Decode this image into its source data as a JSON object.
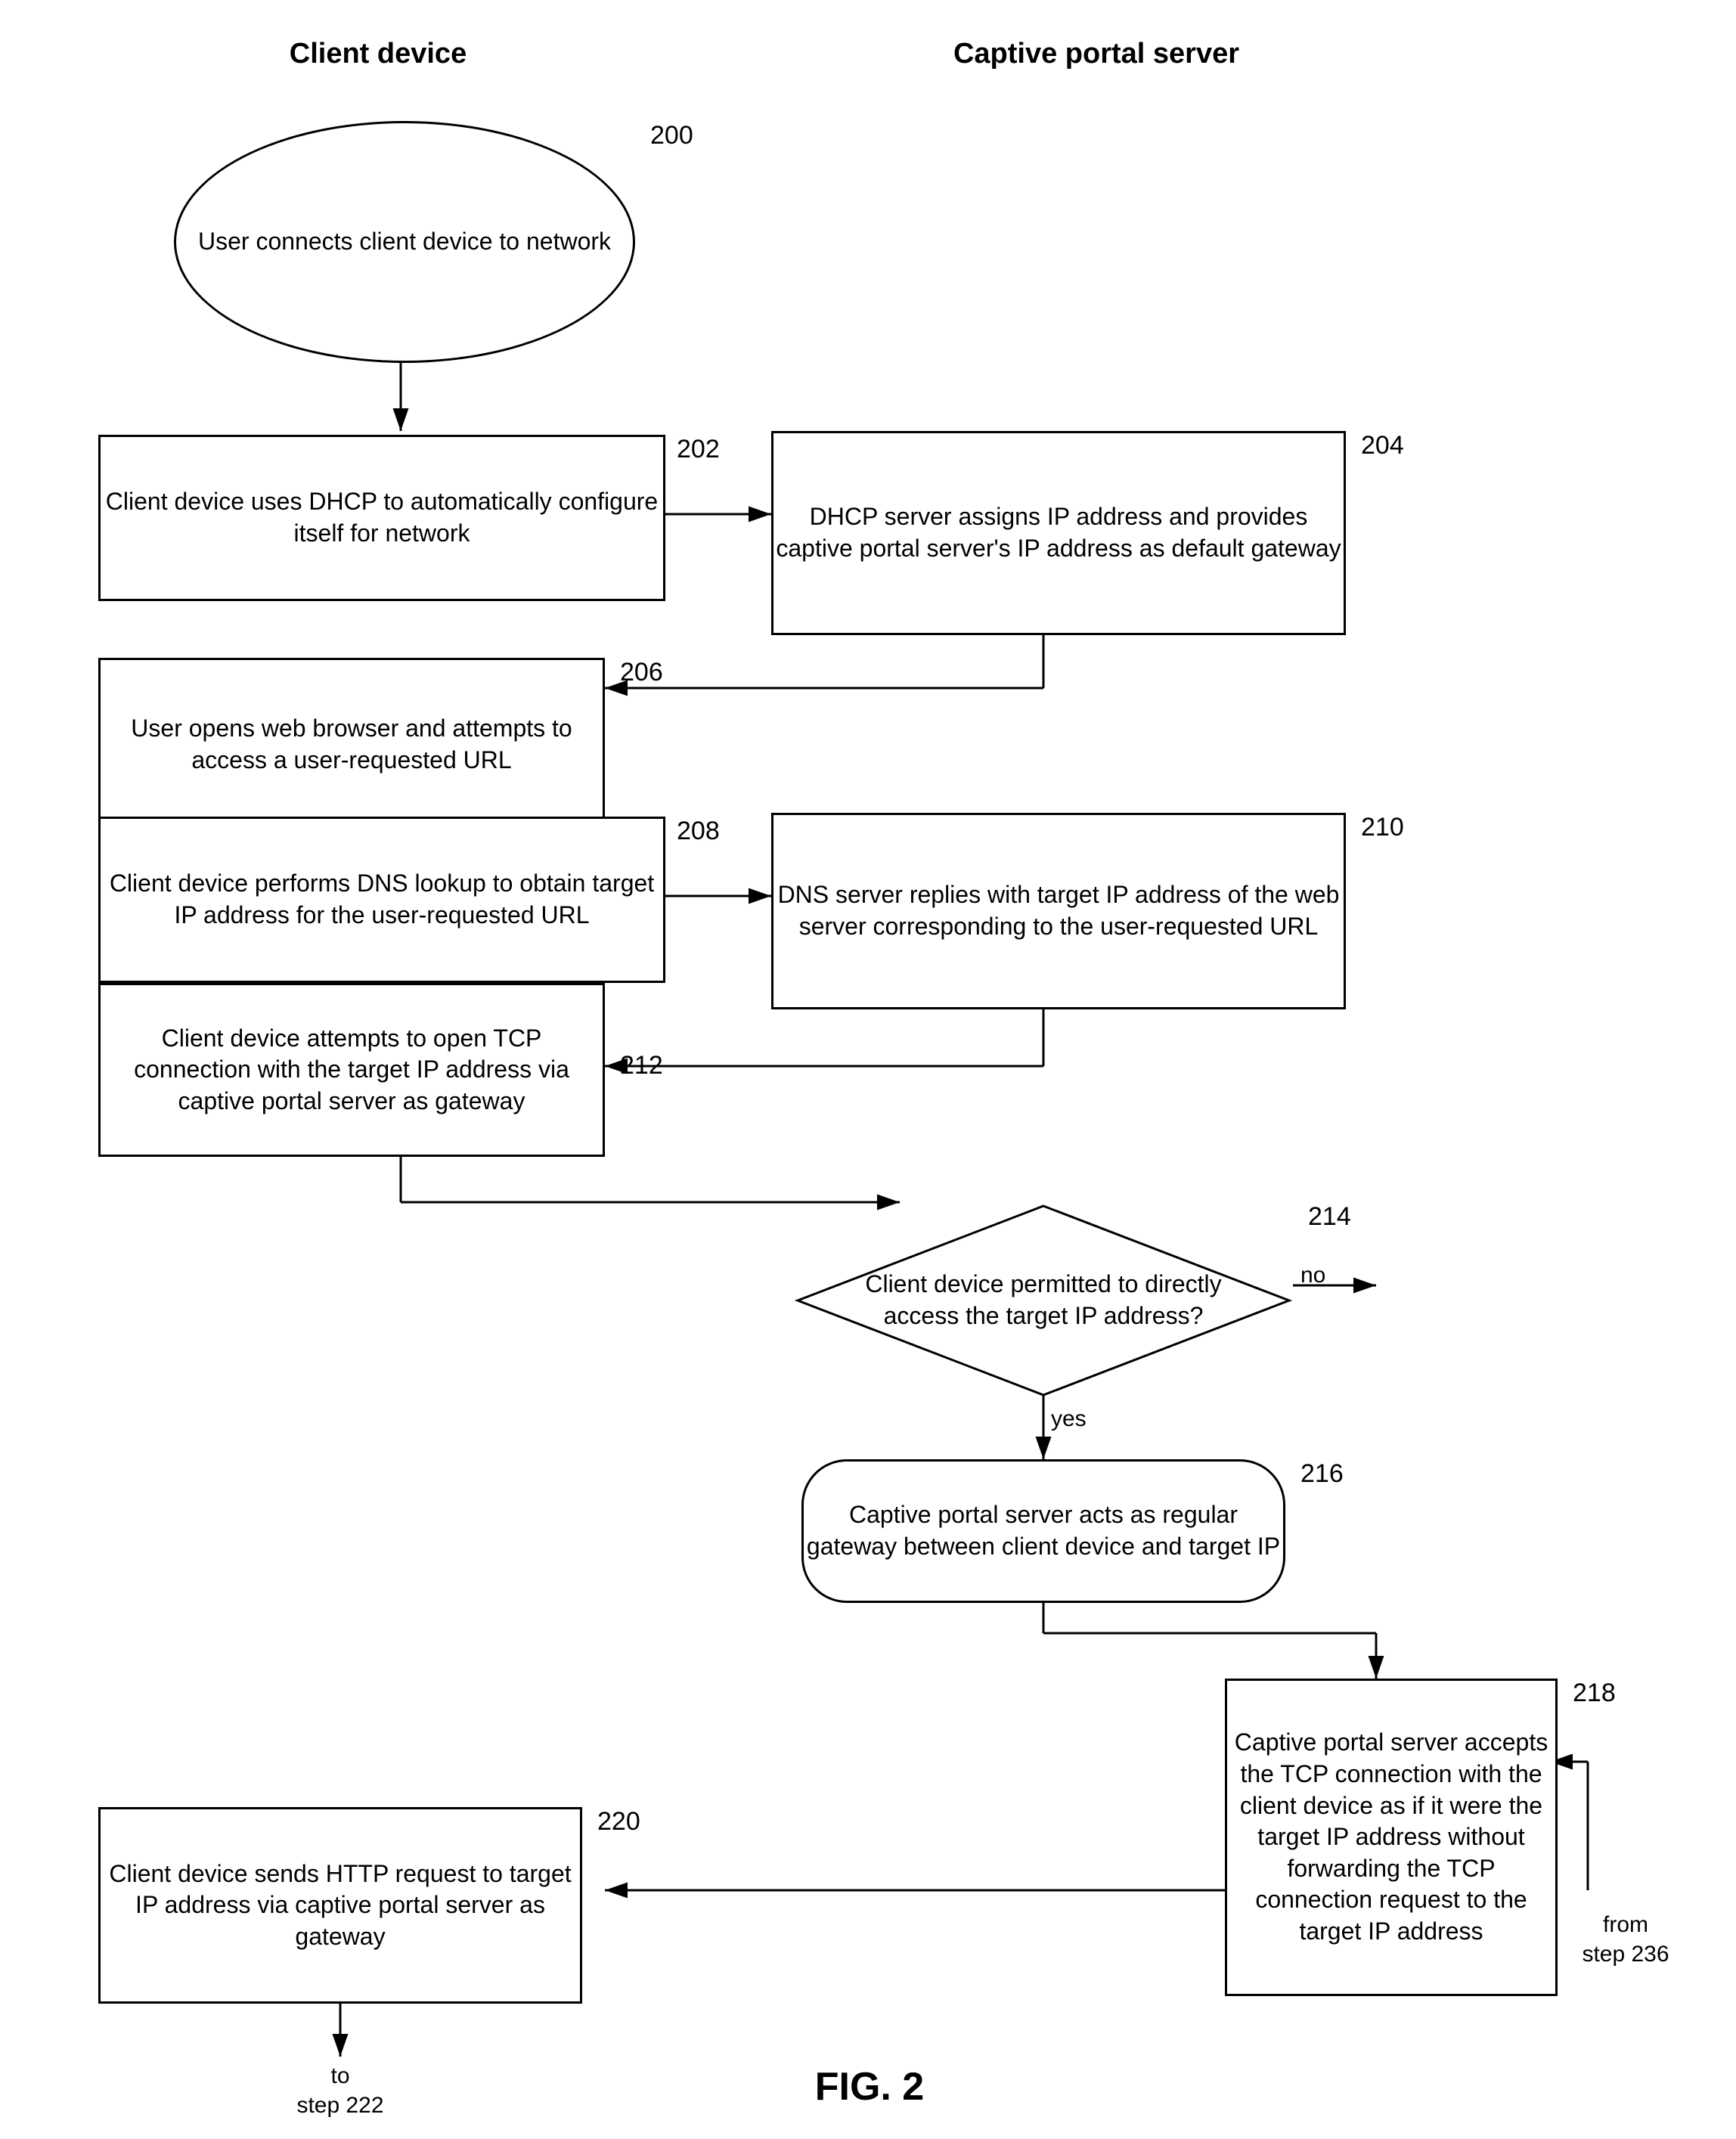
{
  "headers": {
    "client_device": "Client device",
    "captive_portal": "Captive portal server"
  },
  "steps": {
    "s200_label": "200",
    "s202_label": "202",
    "s204_label": "204",
    "s206_label": "206",
    "s208_label": "208",
    "s210_label": "210",
    "s212_label": "212",
    "s214_label": "214",
    "s216_label": "216",
    "s218_label": "218",
    "s220_label": "220"
  },
  "nodes": {
    "n200": "User connects client device to network",
    "n202": "Client device uses DHCP to automatically configure itself for network",
    "n204": "DHCP server assigns IP address and provides captive portal server's IP address as default gateway",
    "n206": "User opens web browser and attempts to access a user-requested URL",
    "n208": "Client device performs DNS lookup to obtain target IP address for the user-requested URL",
    "n210": "DNS server replies with target IP address of the web server corresponding to the user-requested URL",
    "n212": "Client device attempts to open TCP connection with the target IP address via captive portal server as gateway",
    "n214": "Client device permitted to directly access the target IP address?",
    "n216": "Captive portal server acts as regular gateway between client device and target IP",
    "n218": "Captive portal server accepts the TCP connection with the client device as if it were the target IP address without forwarding the TCP connection request to the target IP address",
    "n220": "Client device sends HTTP request to target IP address via captive portal server as gateway"
  },
  "labels": {
    "yes": "yes",
    "no": "no",
    "to_step222": "to\nstep 222",
    "from_step236": "from\nstep 236",
    "fig_caption": "FIG. 2"
  }
}
